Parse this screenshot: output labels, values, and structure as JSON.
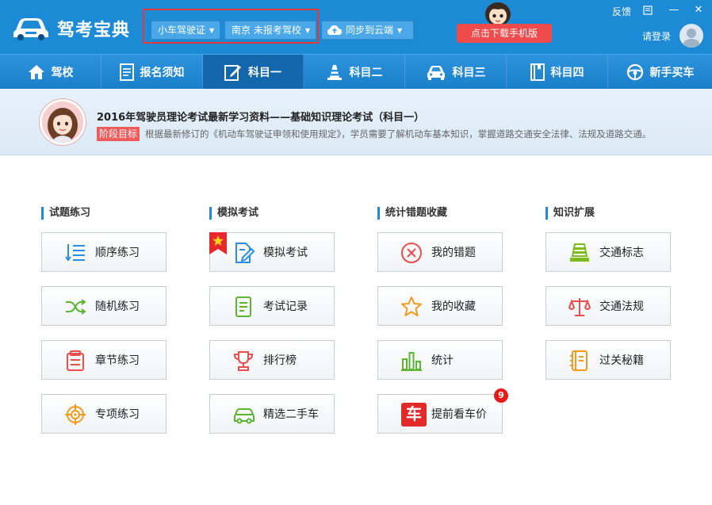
{
  "app": {
    "title": "驾考宝典"
  },
  "header": {
    "license_dropdown": "小车驾驶证",
    "school_dropdown": "南京 未报考驾校",
    "sync_button": "同步到云端",
    "download_button": "点击下载手机版",
    "feedback": "反馈",
    "login": "请登录"
  },
  "nav": {
    "items": [
      {
        "label": "驾校",
        "icon": "home-icon"
      },
      {
        "label": "报名须知",
        "icon": "document-icon"
      },
      {
        "label": "科目一",
        "icon": "edit-icon",
        "active": true
      },
      {
        "label": "科目二",
        "icon": "traffic-cone-icon"
      },
      {
        "label": "科目三",
        "icon": "car-icon"
      },
      {
        "label": "科目四",
        "icon": "book-icon"
      },
      {
        "label": "新手买车",
        "icon": "steering-wheel-icon"
      }
    ]
  },
  "banner": {
    "title": "2016年驾驶员理论考试最新学习资料——基础知识理论考试（科目一）",
    "stage_label": "阶段目标",
    "stage_text": "根据最新修订的《机动车驾驶证申领和使用规定》，学员需要了解机动车基本知识，掌握道路交通安全法律、法规及道路交通。"
  },
  "sections": [
    {
      "title": "试题练习",
      "items": [
        {
          "label": "顺序练习",
          "icon": "list-icon"
        },
        {
          "label": "随机练习",
          "icon": "shuffle-icon"
        },
        {
          "label": "章节练习",
          "icon": "chapter-icon"
        },
        {
          "label": "专项练习",
          "icon": "target-icon"
        }
      ]
    },
    {
      "title": "模拟考试",
      "items": [
        {
          "label": "模拟考试",
          "icon": "exam-edit-icon"
        },
        {
          "label": "考试记录",
          "icon": "record-icon"
        },
        {
          "label": "排行榜",
          "icon": "trophy-icon"
        },
        {
          "label": "精选二手车",
          "icon": "used-car-icon"
        }
      ]
    },
    {
      "title": "统计错题收藏",
      "items": [
        {
          "label": "我的错题",
          "icon": "wrong-icon"
        },
        {
          "label": "我的收藏",
          "icon": "star-icon"
        },
        {
          "label": "统计",
          "icon": "bar-chart-icon"
        },
        {
          "label": "提前看车价",
          "icon": "car-price-icon",
          "badge": "9",
          "icon_text": "车"
        }
      ]
    },
    {
      "title": "知识扩展",
      "items": [
        {
          "label": "交通标志",
          "icon": "traffic-sign-icon"
        },
        {
          "label": "交通法规",
          "icon": "law-scale-icon"
        },
        {
          "label": "过关秘籍",
          "icon": "secret-book-icon"
        }
      ]
    }
  ],
  "colors": {
    "header_blue": "#1d8ad6",
    "nav_active": "#1467ab",
    "download_red": "#ef4b4b",
    "highlight_border": "#e53935"
  }
}
